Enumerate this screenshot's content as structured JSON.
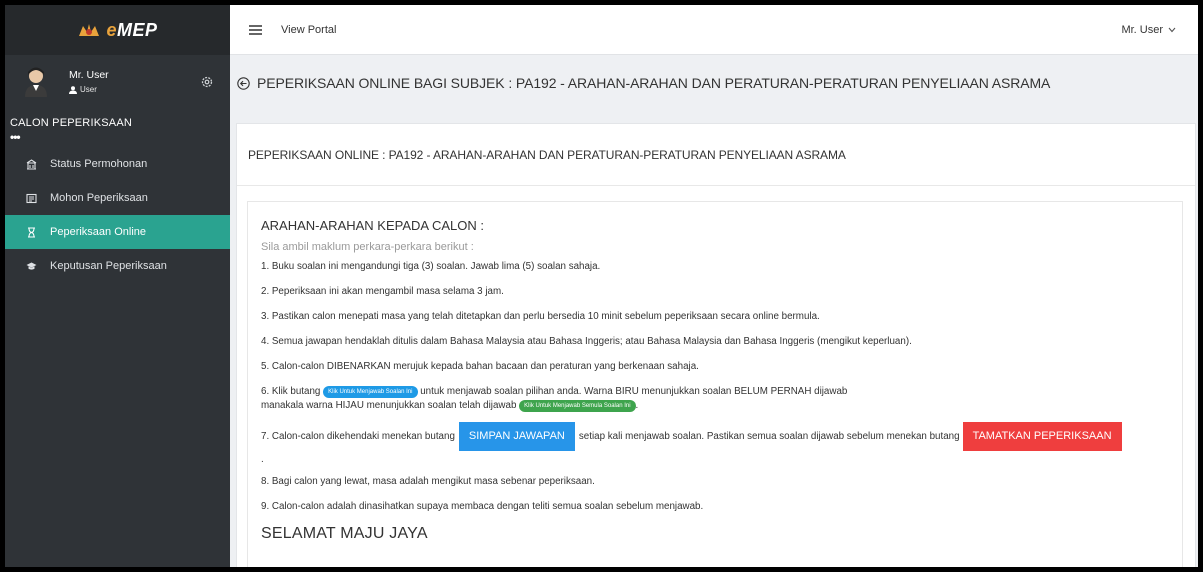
{
  "brand": {
    "logo_icon": "crest-icon",
    "prefix": "e",
    "name": "MEP"
  },
  "user": {
    "name": "Mr. User",
    "role": "User",
    "role_icon": "user-icon"
  },
  "sidebar": {
    "section_header": "CALON PEPERIKSAAN",
    "section_dots": "•••",
    "items": [
      {
        "label": "Status Permohonan",
        "icon": "building-icon",
        "active": false
      },
      {
        "label": "Mohon Peperiksaan",
        "icon": "edit-icon",
        "active": false
      },
      {
        "label": "Peperiksaan Online",
        "icon": "hourglass-icon",
        "active": true
      },
      {
        "label": "Keputusan Peperiksaan",
        "icon": "graduation-cap-icon",
        "active": false
      }
    ]
  },
  "topbar": {
    "portal_link": "View Portal",
    "user_menu": "Mr. User"
  },
  "page": {
    "title": "PEPERIKSAAN ONLINE BAGI SUBJEK : PA192 - ARAHAN-ARAHAN DAN PERATURAN-PERATURAN PENYELIAAN ASRAMA"
  },
  "card": {
    "header": "PEPERIKSAAN ONLINE : PA192 - ARAHAN-ARAHAN DAN PERATURAN-PERATURAN PENYELIAAN ASRAMA",
    "instructions_title": "ARAHAN-ARAHAN KEPADA CALON :",
    "intro": "Sila ambil maklum perkara-perkara berikut :",
    "rules": {
      "r1": "1. Buku soalan ini mengandungi tiga (3) soalan. Jawab lima (5) soalan sahaja.",
      "r2": "2. Peperiksaan ini akan mengambil masa selama 3 jam.",
      "r3": "3. Pastikan calon menepati masa yang telah ditetapkan dan perlu bersedia 10 minit sebelum peperiksaan secara online bermula.",
      "r4": "4. Semua jawapan hendaklah ditulis dalam Bahasa Malaysia atau Bahasa Inggeris; atau Bahasa Malaysia dan Bahasa Inggeris (mengikut keperluan).",
      "r5": "5. Calon-calon DIBENARKAN merujuk kepada bahan bacaan dan peraturan yang berkenaan sahaja.",
      "r6_a": "6. Klik butang",
      "r6_blue_pill": "Klik Untuk Menjawab Soalan Ini",
      "r6_b": "untuk menjawab soalan pilihan anda. Warna BIRU menunjukkan soalan BELUM PERNAH dijawab",
      "r6_c": "manakala warna HIJAU menunjukkan soalan telah dijawab",
      "r6_green_pill": "Klik Untuk Menjawab Semula Soalan Ini",
      "r6_d": ".",
      "r7_a": "7. Calon-calon dikehendaki menekan butang",
      "r7_save_button": "SIMPAN JAWAPAN",
      "r7_b": "setiap kali menjawab soalan. Pastikan semua soalan dijawab sebelum menekan butang",
      "r7_finish_button": "TAMATKAN PEPERIKSAAN",
      "r7_dot": ".",
      "r8": "8. Bagi calon yang lewat, masa adalah mengikut masa sebenar peperiksaan.",
      "r9": "9. Calon-calon adalah dinasihatkan supaya membaca dengan teliti semua soalan sebelum menjawab."
    },
    "closing": "SELAMAT MAJU JAYA"
  },
  "colors": {
    "sidebar_bg": "#2f3337",
    "active_item": "#2aa390",
    "save_button": "#2795e9",
    "finish_button": "#ef3e3e",
    "pill_blue": "#1e9ae6",
    "pill_green": "#3ea44d"
  }
}
